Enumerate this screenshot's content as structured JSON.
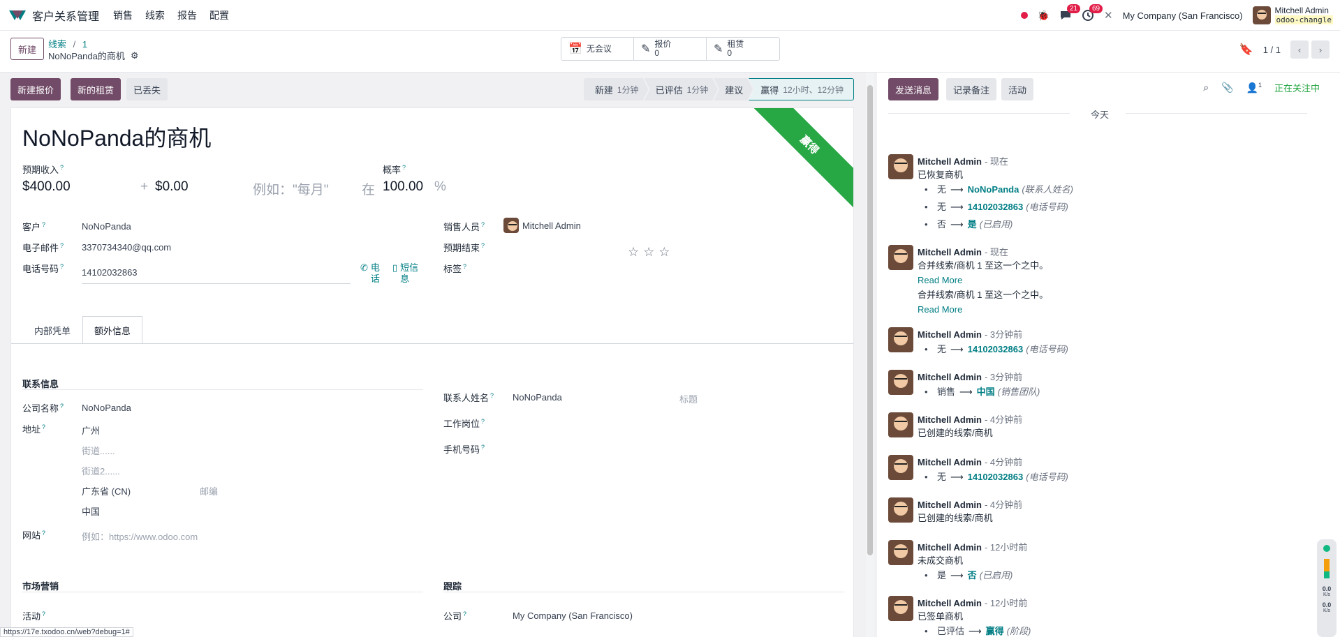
{
  "app": {
    "title": "客户关系管理",
    "menu": [
      "销售",
      "线索",
      "报告",
      "配置"
    ]
  },
  "systray": {
    "messages_count": "21",
    "activities_count": "69",
    "company": "My Company (San Francisco)",
    "user": "Mitchell Admin",
    "db": "odoo-changle"
  },
  "control": {
    "new_label": "新建",
    "breadcrumb_parent": "线索",
    "breadcrumb_sep": "/",
    "breadcrumb_id": "1",
    "record_name": "NoNoPanda的商机",
    "smart": [
      {
        "label": "无会议",
        "sub": ""
      },
      {
        "label": "报价",
        "sub": "0"
      },
      {
        "label": "租赁",
        "sub": "0"
      }
    ],
    "pager": "1 / 1"
  },
  "status": {
    "buttons": [
      "新建报价",
      "新的租赁",
      "已丢失"
    ],
    "stages": [
      {
        "name": "新建",
        "time": "1分钟"
      },
      {
        "name": "已评估",
        "time": "1分钟"
      },
      {
        "name": "建议",
        "time": ""
      },
      {
        "name": "赢得",
        "time": "12小时、12分钟"
      }
    ]
  },
  "form": {
    "title": "NoNoPanda的商机",
    "ribbon": "赢得",
    "expected_revenue_label": "预期收入",
    "expected_revenue": "$400.00",
    "plus": "+",
    "recurring": "$0.00",
    "recurring_placeholder": "例如：\"每月\"",
    "at": "在",
    "probability_label": "概率",
    "probability": "100.00",
    "percent": "%",
    "customer_label": "客户",
    "customer": "NoNoPanda",
    "email_label": "电子邮件",
    "email": "3370734340@qq.com",
    "phone_label": "电话号码",
    "phone": "14102032863",
    "call_label": "电话",
    "sms_label": "短信息",
    "salesperson_label": "销售人员",
    "salesperson": "Mitchell Admin",
    "expected_close_label": "预期结束",
    "tags_label": "标签",
    "tabs": [
      "内部凭单",
      "额外信息"
    ],
    "contact_section": "联系信息",
    "company_name_label": "公司名称",
    "company_name": "NoNoPanda",
    "address_label": "地址",
    "address": [
      "广州",
      "街道......",
      "街道2......",
      "广东省 (CN)",
      "中国"
    ],
    "zip_placeholder": "邮编",
    "website_label": "网站",
    "website_placeholder": "例如：https://www.odoo.com",
    "contact_name_label": "联系人姓名",
    "contact_name": "NoNoPanda",
    "title_placeholder": "标题",
    "job_label": "工作岗位",
    "mobile_label": "手机号码",
    "marketing_section": "市场营销",
    "campaign_label": "活动",
    "tracking_section": "跟踪",
    "company_label": "公司",
    "company": "My Company (San Francisco)"
  },
  "chatter": {
    "send": "发送消息",
    "note": "记录备注",
    "activity": "活动",
    "followers_count": "1",
    "following": "正在关注中",
    "today": "今天",
    "messages": [
      {
        "author": "Mitchell Admin",
        "time": "- 现在",
        "text": "已恢复商机",
        "changes": [
          {
            "old": "无",
            "new": "NoNoPanda",
            "field": "(联系人姓名)"
          },
          {
            "old": "无",
            "new": "14102032863",
            "field": "(电话号码)"
          },
          {
            "old": "否",
            "new": "是",
            "field": "(已启用)"
          }
        ]
      },
      {
        "author": "Mitchell Admin",
        "time": "- 现在",
        "text": "合并线索/商机 1 至这一个之中。",
        "readmore": "Read More",
        "text2": "合并线索/商机 1 至这一个之中。"
      },
      {
        "author": "Mitchell Admin",
        "time": "- 3分钟前",
        "changes": [
          {
            "old": "无",
            "new": "14102032863",
            "field": "(电话号码)"
          }
        ]
      },
      {
        "author": "Mitchell Admin",
        "time": "- 3分钟前",
        "changes": [
          {
            "old": "销售",
            "new": "中国",
            "field": "(销售团队)"
          }
        ]
      },
      {
        "author": "Mitchell Admin",
        "time": "- 4分钟前",
        "text": "已创建的线索/商机"
      },
      {
        "author": "Mitchell Admin",
        "time": "- 4分钟前",
        "changes": [
          {
            "old": "无",
            "new": "14102032863",
            "field": "(电话号码)"
          }
        ]
      },
      {
        "author": "Mitchell Admin",
        "time": "- 4分钟前",
        "text": "已创建的线索/商机"
      },
      {
        "author": "Mitchell Admin",
        "time": "- 12小时前",
        "text": "未成交商机",
        "changes": [
          {
            "old": "是",
            "new": "否",
            "field": "(已启用)"
          }
        ]
      },
      {
        "author": "Mitchell Admin",
        "time": "- 12小时前",
        "text": "已签单商机",
        "changes": [
          {
            "old": "已评估",
            "new": "赢得",
            "field": "(阶段)"
          }
        ]
      }
    ]
  },
  "widget": {
    "up": "0.0",
    "down": "0.0",
    "unit": "K/s"
  },
  "url_tip": "https://17e.txodoo.cn/web?debug=1#"
}
